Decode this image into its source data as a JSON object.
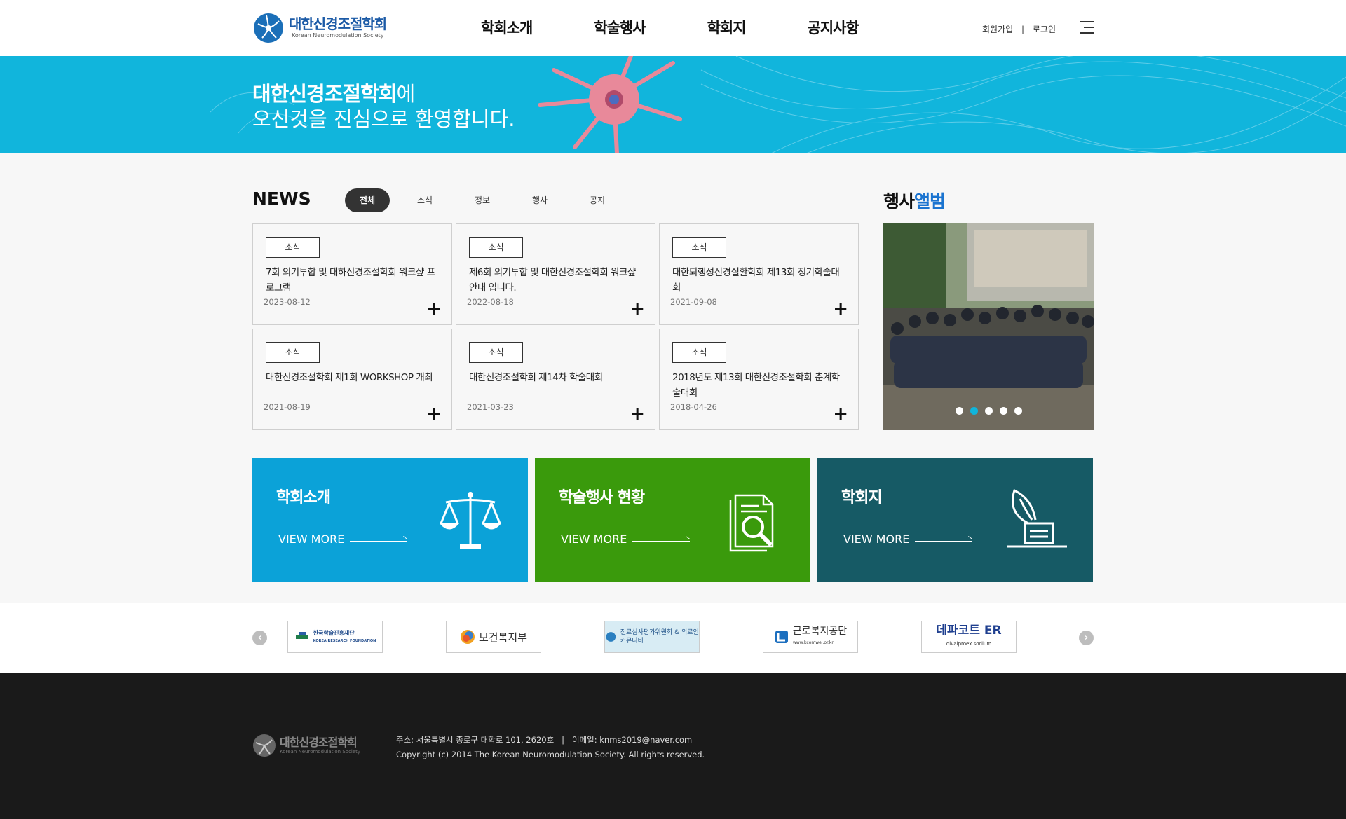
{
  "header": {
    "logo_ko": "대한신경조절학회",
    "logo_en": "Korean Neuromodulation Society",
    "nav": [
      "학회소개",
      "학술행사",
      "학회지",
      "공지사항"
    ],
    "signup": "회원가입",
    "separator": "|",
    "login": "로그인",
    "menu_icon": "hamburger-icon"
  },
  "banner": {
    "line1_bold": "대한신경조절학회",
    "line1_rest": "에",
    "line2": "오신것을 진심으로 환영합니다."
  },
  "news": {
    "title": "NEWS",
    "tabs": [
      "전체",
      "소식",
      "정보",
      "행사",
      "공지"
    ],
    "active_tab": "전체",
    "items": [
      {
        "category": "소식",
        "title": "7회 의기투합 및 대하신경조절학회 워크샾 프로그램",
        "date": "2023-08-12"
      },
      {
        "category": "소식",
        "title": "제6회 의기투합 및 대한신경조절학회 워크샾 안내 입니다.",
        "date": "2022-08-18"
      },
      {
        "category": "소식",
        "title": "대한퇴행성신경질환학회 제13회 정기학술대회",
        "date": "2021-09-08"
      },
      {
        "category": "소식",
        "title": "대한신경조절학회 제1회 WORKSHOP 개최",
        "date": "2021-08-19"
      },
      {
        "category": "소식",
        "title": "대한신경조절학회 제14차 학술대회",
        "date": "2021-03-23"
      },
      {
        "category": "소식",
        "title": "2018년도 제13회 대한신경조절학회 춘계학술대회",
        "date": "2018-04-26"
      }
    ],
    "plus": "+"
  },
  "album": {
    "title_plain": "행사",
    "title_accent": "앨범",
    "slide_count": 5,
    "active_slide": 2
  },
  "promos": [
    {
      "title": "학회소개",
      "more": "VIEW MORE",
      "color": "#0ba2d8",
      "icon": "scale-icon"
    },
    {
      "title": "학술행사 현황",
      "more": "VIEW MORE",
      "color": "#3a9a0c",
      "icon": "document-search-icon"
    },
    {
      "title": "학회지",
      "more": "VIEW MORE",
      "color": "#165a65",
      "icon": "quill-ink-icon"
    }
  ],
  "partners": {
    "items": [
      {
        "name": "한국학술진흥재단",
        "sub": "KOREA RESEARCH FOUNDATION"
      },
      {
        "name": "보건복지부"
      },
      {
        "name": "진료심사평가위원회 & 의료인 커뮤니티"
      },
      {
        "name": "근로복지공단",
        "sub": "www.kcomwel.or.kr"
      },
      {
        "name": "데파코트 ER",
        "sub": "divalproex sodium"
      }
    ]
  },
  "footer": {
    "logo_ko": "대한신경조절학회",
    "logo_en": "Korean Neuromodulation Society",
    "address_label": "주소:",
    "address": "서울특별시 종로구 대학로 101, 2620호",
    "divider": "|",
    "email_label": "이메일:",
    "email": "knms2019@naver.com",
    "copyright": "Copyright (c) 2014 The Korean Neuromodulation Society. All rights reserved."
  }
}
